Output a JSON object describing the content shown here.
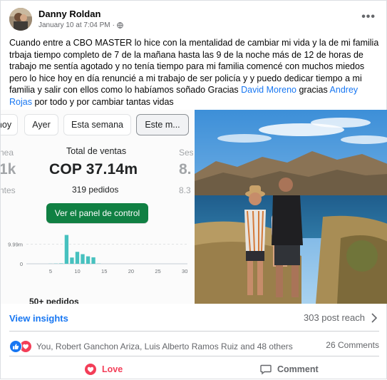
{
  "post": {
    "author": "Danny Roldan",
    "timestamp": "January 10 at 7:04 PM",
    "separator": "·",
    "audience_icon": "globe-icon",
    "menu_icon": "more-options-icon",
    "menu_glyph": "•••",
    "text": {
      "part1": "Cuando entre a CBO MASTER lo hice con la mentalidad de cambiar mi vida y la de mi familia trbaja tiempo completo de 7 de la mañana hasta las 9 de la noche más de 12 de horas de trabajo me sentía agotado y no tenía tiempo para mi familia comencé con muchos miedos pero lo hice hoy en día renuncié a mi trabajo de ser policía y y puedo dedicar tiempo a mi familia y salir con ellos como lo habíamos soñado Gracias ",
      "mention1": "David Moreno",
      "part2": " gracias ",
      "mention2": "Andrey Rojas",
      "part3": " por todo y por cambiar tantas vidas"
    }
  },
  "dashboard": {
    "tabs": [
      "hoy",
      "Ayer",
      "Esta semana",
      "Este m..."
    ],
    "active_tab": "Este m...",
    "left_col": {
      "title": "nea",
      "value": "1k",
      "sub": "ntes"
    },
    "right_col": {
      "title": "Ses",
      "value": "8.",
      "sub": "8.3"
    },
    "stat_title": "Total de ventas",
    "stat_value": "COP 37.14m",
    "stat_sub": "319 pedidos",
    "cta_label": "Ver el panel de control",
    "more_orders": "50+ pedidos",
    "chart_data": {
      "type": "bar",
      "y_tick_labels": [
        "9.99m",
        "0"
      ],
      "x_tick_labels": [
        "5",
        "10",
        "15",
        "20",
        "25",
        "30"
      ],
      "categories": [
        1,
        2,
        3,
        4,
        5,
        6,
        7,
        8,
        9,
        10,
        11,
        12,
        13,
        14,
        15,
        16,
        17,
        18,
        19,
        20,
        21,
        22,
        23,
        24,
        25,
        26,
        27,
        28,
        29,
        30
      ],
      "values": [
        0,
        0,
        0,
        0,
        0.05,
        0.1,
        0.2,
        14.7,
        3.2,
        6.1,
        4.9,
        3.8,
        3.3,
        0.1,
        0,
        0,
        0,
        0,
        0,
        0,
        0,
        0,
        0,
        0,
        0,
        0,
        0,
        0,
        0,
        0
      ],
      "ylim": [
        0,
        16
      ],
      "grid": true,
      "color": "#47c1bf"
    }
  },
  "insights": {
    "label": "View insights",
    "reach": "303 post reach",
    "chevron_icon": "chevron-right-icon"
  },
  "reactions": {
    "icons": [
      "like-icon",
      "love-icon"
    ],
    "names": "You, Robert Ganchon Ariza, Luis Alberto Ramos Ruiz and 48 others",
    "comments": "26 Comments"
  },
  "actions": {
    "love": "Love",
    "comment": "Comment"
  },
  "colors": {
    "link": "#1877f2",
    "secondary_text": "#65676b",
    "love": "#f33e58",
    "like": "#1877f2",
    "cta_green": "#108043"
  }
}
